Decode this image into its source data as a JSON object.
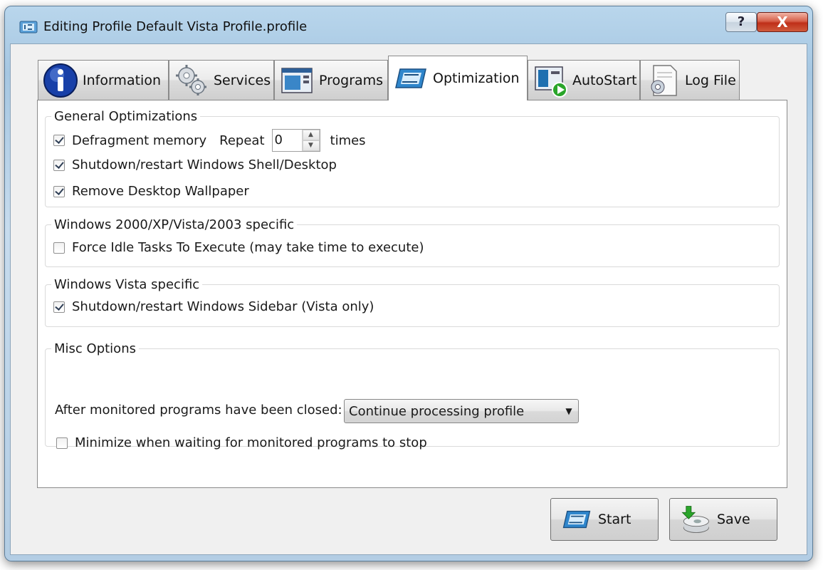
{
  "window": {
    "title": "Editing Profile Default Vista Profile.profile",
    "help_label": "?",
    "close_label": "X"
  },
  "tabs": [
    {
      "label": "Information",
      "icon": "info-icon"
    },
    {
      "label": "Services",
      "icon": "gears-icon"
    },
    {
      "label": "Programs",
      "icon": "programs-window-icon"
    },
    {
      "label": "Optimization",
      "icon": "optimization-icon",
      "active": true
    },
    {
      "label": "AutoStart",
      "icon": "autostart-play-icon"
    },
    {
      "label": "Log File",
      "icon": "log-file-icon"
    }
  ],
  "general": {
    "legend": "General Optimizations",
    "defrag_label": "Defragment memory",
    "defrag_checked": true,
    "repeat_label": "Repeat",
    "repeat_value": "0",
    "times_label": "times",
    "shell_label": "Shutdown/restart Windows Shell/Desktop",
    "shell_checked": true,
    "wallpaper_label": "Remove Desktop Wallpaper",
    "wallpaper_checked": true
  },
  "win2000": {
    "legend": "Windows 2000/XP/Vista/2003 specific",
    "idle_label": "Force Idle Tasks To Execute (may take time to execute)",
    "idle_checked": false
  },
  "vista": {
    "legend": "Windows Vista specific",
    "sidebar_label": "Shutdown/restart Windows Sidebar (Vista only)",
    "sidebar_checked": true
  },
  "misc": {
    "legend": "Misc Options",
    "after_label": "After monitored programs have been closed:",
    "after_selected": "Continue processing profile",
    "minimize_label": "Minimize when waiting for monitored programs to stop",
    "minimize_checked": false
  },
  "buttons": {
    "start_label": "Start",
    "save_label": "Save"
  },
  "colors": {
    "title_bar": "#b9d6ec",
    "close_red": "#c8402a",
    "panel_bg": "#ffffff",
    "client_bg": "#f0f0f0"
  }
}
